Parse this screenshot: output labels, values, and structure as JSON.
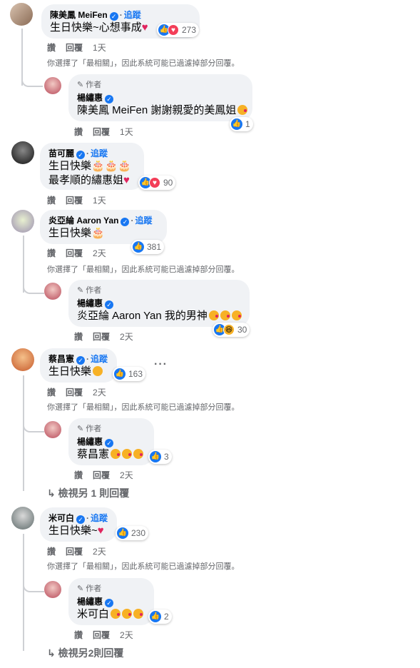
{
  "common": {
    "like_label": "讚",
    "reply_label": "回覆",
    "follow_label": "追蹤",
    "author_label": "作者",
    "filter_note": "你選擇了「最相關」，因此系統可能已過濾掉部分回覆。"
  },
  "comments": [
    {
      "name": "陳美鳳 MeiFen",
      "text": "生日快樂~心想事成",
      "reaction_count": "273",
      "time": "1天",
      "reply": {
        "name": "楊繡惠",
        "text": "陳美鳳 MeiFen 謝謝親愛的美鳳姐",
        "reaction_count": "1",
        "time": "1天"
      }
    },
    {
      "name": "苗可麗",
      "text_line1": "生日快樂",
      "text_line2": "最孝順的繡惠姐",
      "reaction_count": "90",
      "time": "1天"
    },
    {
      "name": "炎亞綸 Aaron Yan",
      "text": "生日快樂",
      "reaction_count": "381",
      "time": "2天",
      "reply": {
        "name": "楊繡惠",
        "text": "炎亞綸 Aaron Yan 我的男神",
        "reaction_count": "30",
        "time": "2天"
      }
    },
    {
      "name": "蔡昌憲",
      "text": "生日快樂",
      "reaction_count": "163",
      "time": "2天",
      "reply": {
        "name": "楊繡惠",
        "text": "蔡昌憲",
        "reaction_count": "3",
        "time": "2天"
      },
      "view_more": "檢視另 1 則回覆"
    },
    {
      "name": "米可白",
      "text": "生日快樂~",
      "reaction_count": "230",
      "time": "2天",
      "reply": {
        "name": "楊繡惠",
        "text": "米可白",
        "reaction_count": "2",
        "time": "2天"
      },
      "view_more": "檢視另2則回覆"
    }
  ],
  "icons": {
    "verified": "verified-badge-icon",
    "like": "like-reaction-icon",
    "love": "love-reaction-icon",
    "haha": "haha-reaction-icon",
    "reply_arrow": "reply-arrow-icon",
    "pen": "pen-icon",
    "more": "more-options-icon"
  },
  "colors": {
    "link_blue": "#1877f2",
    "bubble_bg": "#f0f2f5",
    "secondary_text": "#65676b",
    "heart_red": "#e0245e"
  }
}
